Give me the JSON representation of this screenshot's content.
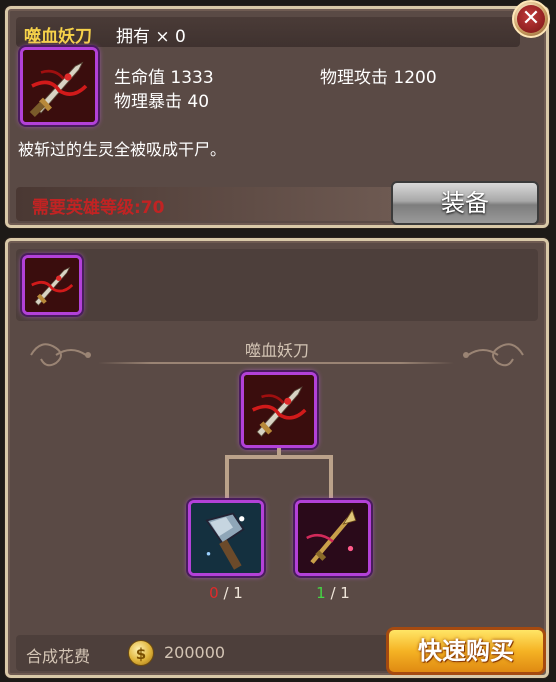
{
  "item": {
    "name": "噬血妖刀",
    "owned_label": "拥有 × 0",
    "stats": {
      "hp": "生命值 1333",
      "phys_attack": "物理攻击 1200",
      "phys_crit": "物理暴击 40"
    },
    "description": "被斩过的生灵全被吸成干尸。",
    "required_level_text": "需要英雄等级:70",
    "equip_label": "装备"
  },
  "recipe": {
    "title": "噬血妖刀",
    "materials": [
      {
        "icon": "hammer-icon",
        "have": "0",
        "need": "/ 1",
        "color": "#e02a2a"
      },
      {
        "icon": "spear-icon",
        "have": "1",
        "need": "/ 1",
        "color": "#45d445"
      }
    ],
    "cost_label": "合成花费",
    "coin_symbol": "$",
    "cost_value": "200000",
    "buy_label": "快速购买"
  },
  "colors": {
    "title_gold": "#f6d24a",
    "requirement_red": "#c12323",
    "epic_border": "#b341d8",
    "panel_bg": "#5a4a45"
  }
}
